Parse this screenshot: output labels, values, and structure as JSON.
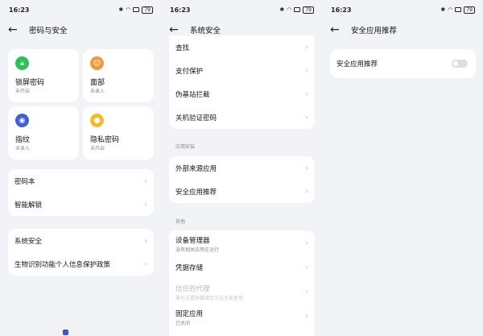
{
  "status": {
    "time": "16:23",
    "battery": "79"
  },
  "panel1": {
    "title": "密码与安全",
    "tiles": [
      {
        "label": "锁屏密码",
        "sub": "未开启",
        "icon": "lock-icon",
        "color": "#2fbf5a"
      },
      {
        "label": "面部",
        "sub": "未录入",
        "icon": "face-icon",
        "color": "#f09a3a"
      },
      {
        "label": "指纹",
        "sub": "未录入",
        "icon": "fingerprint-icon",
        "color": "#3f5fd6"
      },
      {
        "label": "隐私密码",
        "sub": "未开启",
        "icon": "privacy-key-icon",
        "color": "#f5b82e"
      }
    ],
    "group1": [
      "密码本",
      "智能解锁"
    ],
    "group2": [
      "系统安全",
      "生物识别功能个人信息保护政策"
    ]
  },
  "panel2": {
    "title": "系统安全",
    "group1": [
      "查找",
      "支付保护",
      "伪基站拦截",
      "关机验证密码"
    ],
    "section_app": "应用安装",
    "group2": [
      "外部来源应用",
      "安全应用推荐"
    ],
    "section_other": "其他",
    "group3": [
      {
        "label": "设备管理器",
        "sub": "没有相关应用在运行"
      },
      {
        "label": "凭据存储",
        "sub": ""
      },
      {
        "label": "信任的代理",
        "sub": "需先设置屏幕锁定方式才能使用"
      },
      {
        "label": "固定应用",
        "sub": "已关闭"
      }
    ]
  },
  "panel3": {
    "title": "安全应用推荐",
    "row_label": "安全应用推荐",
    "toggle_on": false
  },
  "watermark": {
    "text": ""
  }
}
